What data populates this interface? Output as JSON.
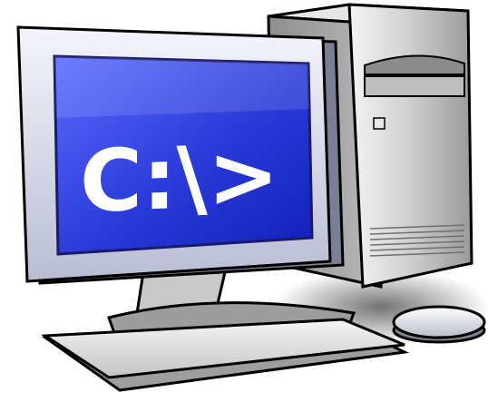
{
  "screen": {
    "prompt_text": "C:\\>"
  },
  "colors": {
    "screen_blue": "#1f2fd0",
    "screen_blue_light": "#5d74ff",
    "monitor_bezel": "#d9dcec",
    "tower_body": "#c9c9c9",
    "keyboard_body": "#dedede",
    "outline": "#000000"
  },
  "icons": {
    "computer": "desktop-computer-clipart",
    "monitor": "monitor-icon",
    "tower": "tower-case-icon",
    "keyboard": "keyboard-icon",
    "mouse": "mouse-icon"
  }
}
